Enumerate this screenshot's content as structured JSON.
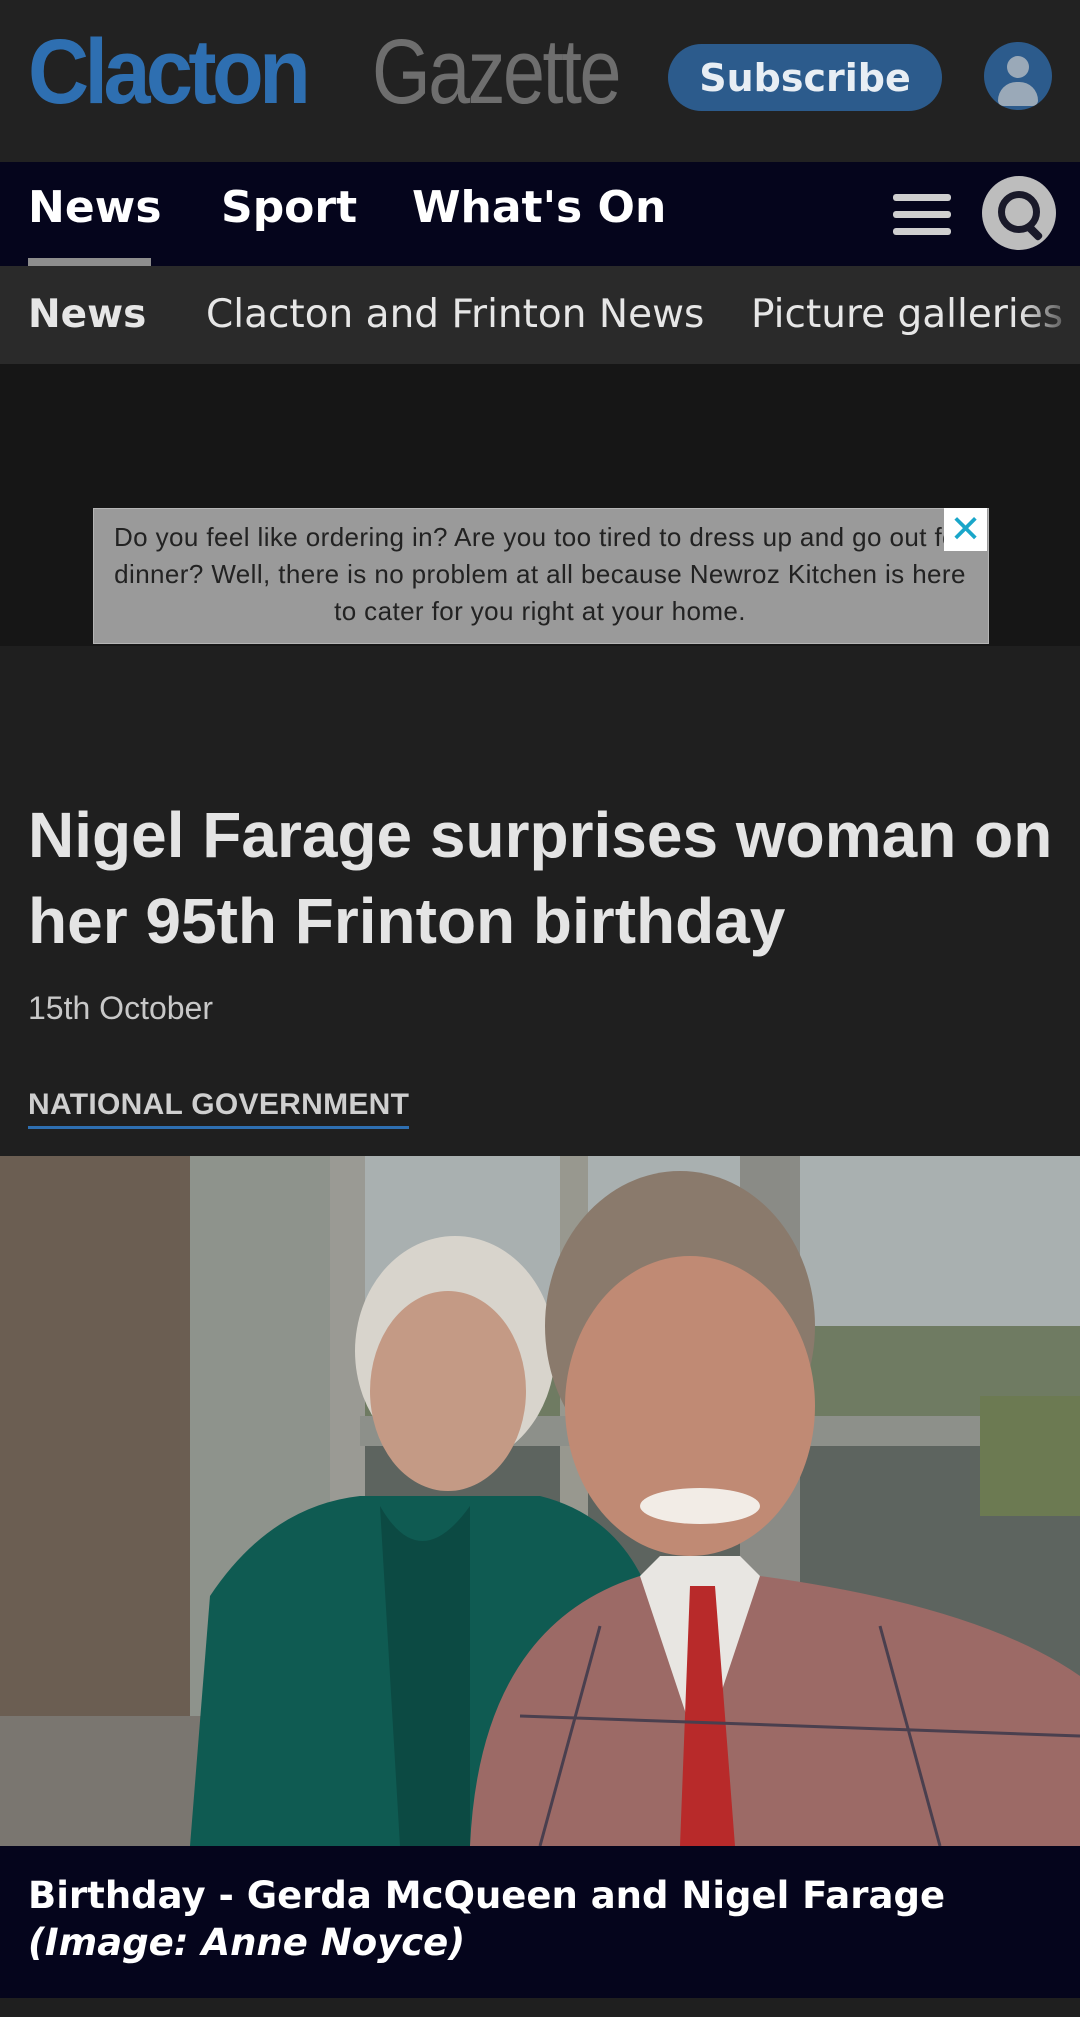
{
  "header": {
    "logo_part1": "Clacton",
    "logo_part2": "Gazette",
    "subscribe_label": "Subscribe"
  },
  "nav": {
    "items": [
      {
        "label": "News",
        "active": true
      },
      {
        "label": "Sport"
      },
      {
        "label": "What's On"
      }
    ]
  },
  "subnav": {
    "items": [
      {
        "label": "News",
        "active": true
      },
      {
        "label": "Clacton and Frinton News"
      },
      {
        "label": "Picture galleries"
      }
    ]
  },
  "ad": {
    "text": "Do you feel like ordering in? Are you too tired to dress up and go out for dinner? Well, there is no problem at all because Newroz Kitchen is here to cater for you right at your home."
  },
  "article": {
    "headline": "Nigel Farage surprises woman on her 95th Frinton birthday",
    "date": "15th October",
    "category": "NATIONAL GOVERNMENT",
    "caption": "Birthday - Gerda McQueen and Nigel Farage",
    "caption_credit": "(Image: Anne Noyce)"
  },
  "colors": {
    "brand_blue": "#2e6fb1",
    "nav_bg": "#05051c",
    "page_bg": "#1f1f1f"
  }
}
